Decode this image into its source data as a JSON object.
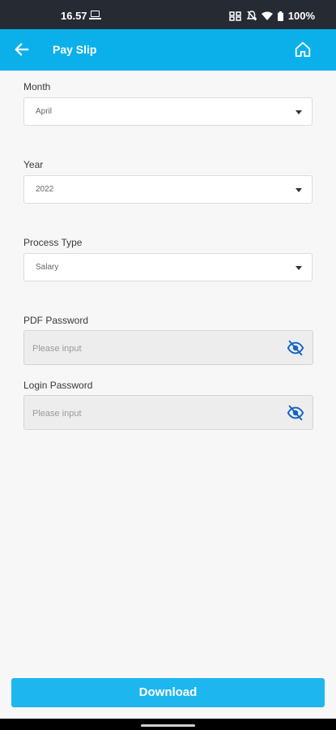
{
  "status_bar": {
    "time": "16.57",
    "battery": "100%",
    "icons": [
      "laptop-icon",
      "nfc-icon",
      "mute-icon",
      "wifi-icon",
      "battery-icon"
    ]
  },
  "app_bar": {
    "title": "Pay Slip",
    "back_icon": "arrow-left-icon",
    "home_icon": "home-icon",
    "color": "#0bb0ea"
  },
  "form": {
    "month": {
      "label": "Month",
      "value": "April"
    },
    "year": {
      "label": "Year",
      "value": "2022"
    },
    "process_type": {
      "label": "Process Type",
      "value": "Salary"
    },
    "pdf_password": {
      "label": "PDF Password",
      "placeholder": "Please input",
      "value": ""
    },
    "login_password": {
      "label": "Login Password",
      "placeholder": "Please input",
      "value": ""
    }
  },
  "download_button": {
    "label": "Download",
    "color": "#1eb6ef"
  }
}
